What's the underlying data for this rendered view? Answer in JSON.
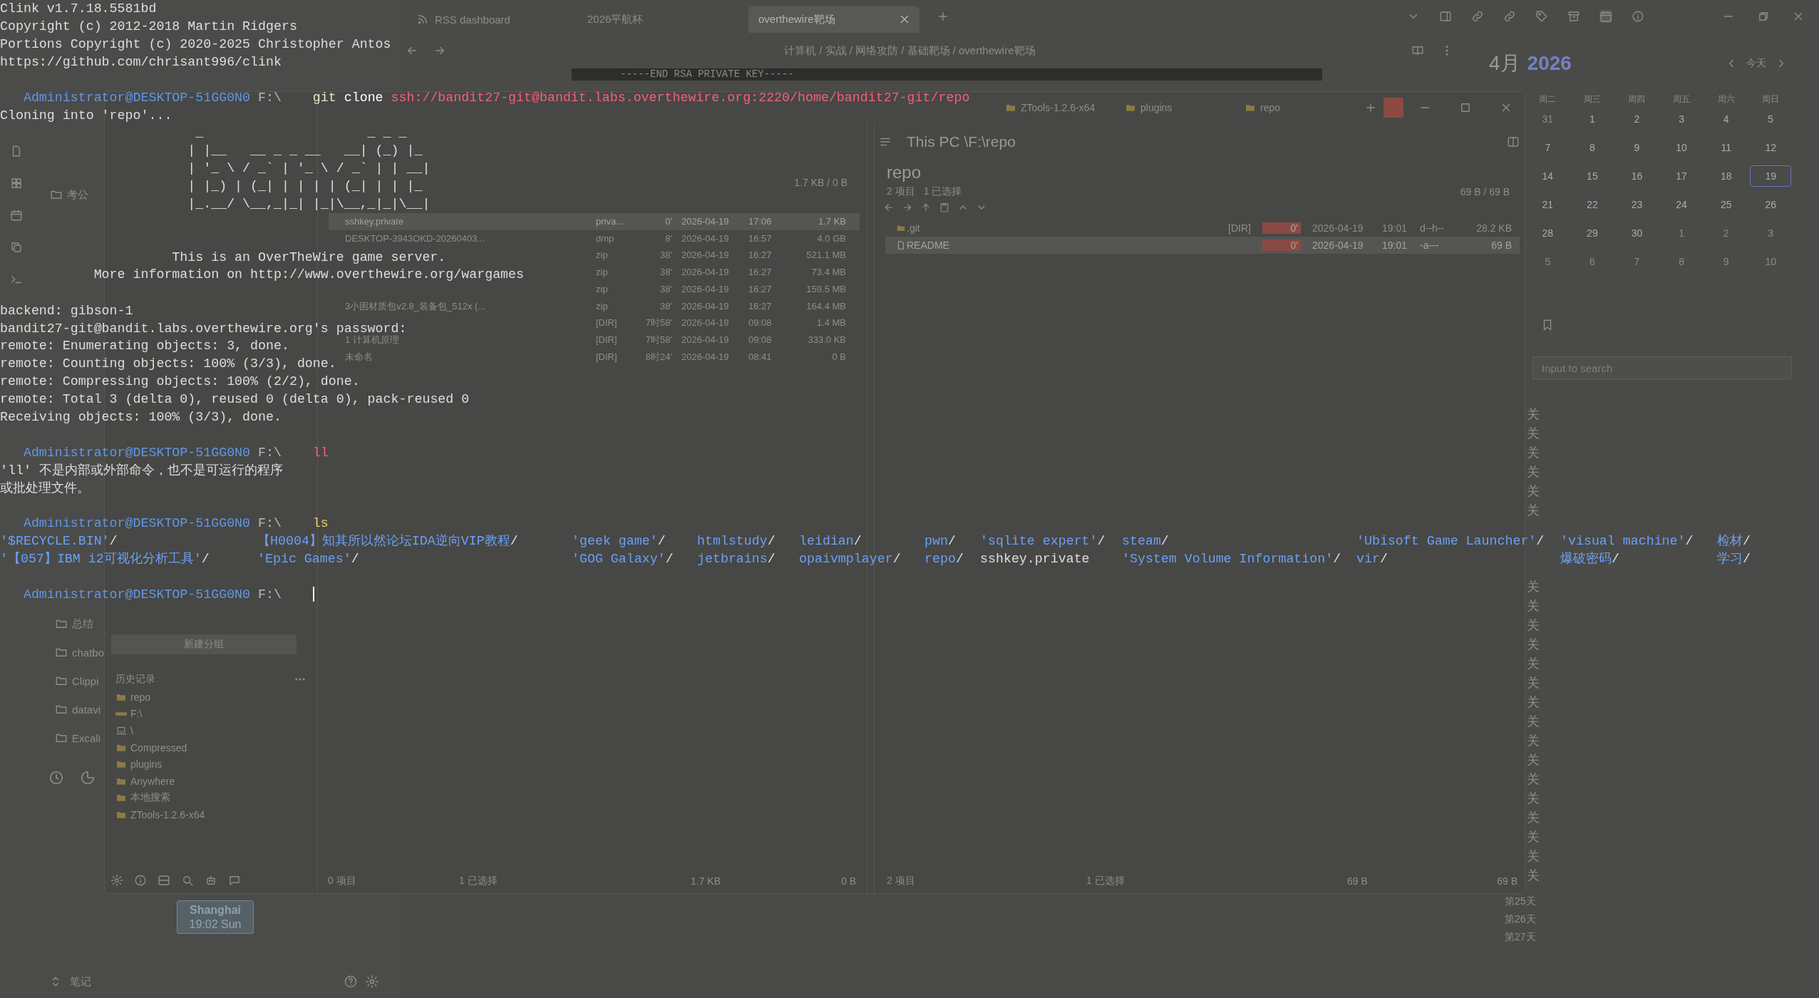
{
  "browser": {
    "tabs": [
      {
        "label": "RSS dashboard",
        "selected": false
      },
      {
        "label": "2026平航杯",
        "selected": false
      },
      {
        "label": "overthewire靶场",
        "selected": true
      }
    ],
    "breadcrumb": "计算机 / 实战 / 网络攻防 / 基础靶场 / overthewire靶场",
    "key_line": "-----END RSA PRIVATE KEY-----"
  },
  "notes": {
    "folder": "考公",
    "folders": [
      "总结",
      "chatbo",
      "Clippi",
      "datavi",
      "Excali"
    ],
    "clock": {
      "city": "Shanghai",
      "time": "19:02 Sun"
    },
    "footer": "笔记"
  },
  "calendar": {
    "month": "4月",
    "year": "2026",
    "today_button": "今天",
    "weekdays": [
      "周二",
      "周三",
      "周四",
      "周五",
      "周六",
      "周日"
    ],
    "weeks": [
      [
        {
          "day": "31",
          "outside": true,
          "selected": false
        },
        {
          "day": "1",
          "outside": false,
          "selected": false
        },
        {
          "day": "2",
          "outside": false,
          "selected": false
        },
        {
          "day": "3",
          "outside": false,
          "selected": false
        },
        {
          "day": "4",
          "outside": false,
          "selected": false
        },
        {
          "day": "5",
          "outside": false,
          "selected": false
        }
      ],
      [
        {
          "day": "7",
          "outside": false,
          "selected": false
        },
        {
          "day": "8",
          "outside": false,
          "selected": false
        },
        {
          "day": "9",
          "outside": false,
          "selected": false
        },
        {
          "day": "10",
          "outside": false,
          "selected": false
        },
        {
          "day": "11",
          "outside": false,
          "selected": false
        },
        {
          "day": "12",
          "outside": false,
          "selected": false
        }
      ],
      [
        {
          "day": "14",
          "outside": false,
          "selected": false
        },
        {
          "day": "15",
          "outside": false,
          "selected": false
        },
        {
          "day": "16",
          "outside": false,
          "selected": false
        },
        {
          "day": "17",
          "outside": false,
          "selected": false
        },
        {
          "day": "18",
          "outside": false,
          "selected": false
        },
        {
          "day": "19",
          "outside": false,
          "selected": true
        }
      ],
      [
        {
          "day": "21",
          "outside": false,
          "selected": false
        },
        {
          "day": "22",
          "outside": false,
          "selected": false
        },
        {
          "day": "23",
          "outside": false,
          "selected": false
        },
        {
          "day": "24",
          "outside": false,
          "selected": false
        },
        {
          "day": "25",
          "outside": false,
          "selected": false
        },
        {
          "day": "26",
          "outside": false,
          "selected": false
        }
      ],
      [
        {
          "day": "28",
          "outside": false,
          "selected": false
        },
        {
          "day": "29",
          "outside": false,
          "selected": false
        },
        {
          "day": "30",
          "outside": false,
          "selected": false
        },
        {
          "day": "1",
          "outside": true,
          "selected": false
        },
        {
          "day": "2",
          "outside": true,
          "selected": false
        },
        {
          "day": "3",
          "outside": true,
          "selected": false
        }
      ],
      [
        {
          "day": "5",
          "outside": true,
          "selected": false
        },
        {
          "day": "6",
          "outside": true,
          "selected": false
        },
        {
          "day": "7",
          "outside": true,
          "selected": false
        },
        {
          "day": "8",
          "outside": true,
          "selected": false
        },
        {
          "day": "9",
          "outside": true,
          "selected": false
        },
        {
          "day": "10",
          "outside": true,
          "selected": false
        }
      ]
    ],
    "search": {
      "placeholder": "Input to search"
    },
    "cut_labels_upper": [
      "关",
      "关",
      "关",
      "关",
      "关",
      "关"
    ],
    "cut_labels_lower": [
      "关",
      "关",
      "关",
      "关",
      "关",
      "关",
      "关",
      "关",
      "关",
      "关",
      "关",
      "关",
      "关",
      "关",
      "关",
      "关"
    ],
    "day_labels": [
      "第25天",
      "第26天",
      "第27天"
    ]
  },
  "file_manager": {
    "tabs": [
      {
        "label": "ZTools-1.2.6-x64"
      },
      {
        "label": "plugins"
      },
      {
        "label": "repo"
      }
    ],
    "sidebar": {
      "new_group_button": "新建分组",
      "history_title": "历史记录",
      "history": [
        {
          "label": "repo",
          "kind": "folder"
        },
        {
          "label": "F:\\",
          "kind": "drive"
        },
        {
          "label": "\\",
          "kind": "computer"
        },
        {
          "label": "Compressed",
          "kind": "folder"
        },
        {
          "label": "plugins",
          "kind": "folder"
        },
        {
          "label": "Anywhere",
          "kind": "folder"
        },
        {
          "label": "本地搜索",
          "kind": "folder"
        },
        {
          "label": "ZTools-1.2.6-x64",
          "kind": "folder"
        }
      ]
    },
    "left_panel": {
      "summary": "1.7 KB / 0 B",
      "rows": [
        {
          "name": "sshkey.private",
          "type": "priva...",
          "age": "0'",
          "date": "2026-04-19",
          "time": "17:06",
          "size": "1.7 KB",
          "selected": true
        },
        {
          "name": "DESKTOP-3943OKD-20260403...",
          "type": "dmp",
          "age": "8'",
          "date": "2026-04-19",
          "time": "16:57",
          "size": "4.0 GB",
          "selected": false
        },
        {
          "type": "zip",
          "age": "38'",
          "date": "2026-04-19",
          "time": "16:27",
          "size": "521.1 MB",
          "selected": false
        },
        {
          "type": "zip",
          "age": "38'",
          "date": "2026-04-19",
          "time": "16:27",
          "size": "73.4 MB",
          "selected": false
        },
        {
          "type": "zip",
          "age": "38'",
          "date": "2026-04-19",
          "time": "16:27",
          "size": "159.5 MB",
          "selected": false
        },
        {
          "name": "3小困材质包v2.8_装备包_512x (...",
          "type": "zip",
          "age": "38'",
          "date": "2026-04-19",
          "time": "16:27",
          "size": "164.4 MB",
          "selected": false
        },
        {
          "type": "[DIR]",
          "age": "7时58'",
          "date": "2026-04-19",
          "time": "09:08",
          "size": "1.4 MB",
          "selected": false
        },
        {
          "name": "1 计算机原理",
          "type": "[DIR]",
          "age": "7时58'",
          "date": "2026-04-19",
          "time": "09:08",
          "size": "333.0 KB",
          "selected": false
        },
        {
          "name": "未命名",
          "type": "[DIR]",
          "age": "8时24'",
          "date": "2026-04-19",
          "time": "08:41",
          "size": "0 B",
          "selected": false
        }
      ],
      "status": [
        "0 项目",
        "1 已选择",
        "1.7 KB",
        "0 B"
      ]
    },
    "right_panel": {
      "path": "This PC \\F:\\repo",
      "title": "repo",
      "summary": [
        "2 项目",
        "1 已选择"
      ],
      "size_summary": "69 B / 69 B",
      "rows": [
        {
          "kind": "folder",
          "name": ".git",
          "type": "[DIR]",
          "age": "0'",
          "date": "2026-04-19",
          "time": "19:01",
          "attrs": "d--h--",
          "size": "28.2 KB",
          "selected": false
        },
        {
          "kind": "file",
          "name": "README",
          "age": "0'",
          "date": "2026-04-19",
          "time": "19:01",
          "attrs": "-a---",
          "size": "69 B",
          "selected": true
        }
      ],
      "status": [
        "2 项目",
        "1 已选择",
        "69 B",
        "69 B"
      ]
    }
  },
  "terminal": {
    "lines": [
      {
        "kind": "text",
        "text": "Clink v1.7.18.5581bd"
      },
      {
        "kind": "text",
        "text": "Copyright (c) 2012-2018 Martin Ridgers"
      },
      {
        "kind": "text",
        "text": "Portions Copyright (c) 2020-2025 Christopher Antos"
      },
      {
        "kind": "text",
        "text": "https://github.com/chrisant996/clink"
      },
      {
        "kind": "blank"
      },
      {
        "kind": "prompt",
        "user": "Administrator@DESKTOP-51GG0N0",
        "path": "F:\\",
        "command": [
          {
            "text": "git",
            "kind": "program"
          },
          {
            "text": "clone",
            "kind": "arg"
          },
          {
            "text": "ssh://bandit27-git@bandit.labs.overthewire.org:2220/home/bandit27-git/repo",
            "kind": "url"
          }
        ],
        "cursor": false
      },
      {
        "kind": "text",
        "text": "Cloning into 'repo'..."
      },
      {
        "kind": "art",
        "lines": [
          " _                     _ _ _",
          "| |__   __ _ _ __   __| (_) |_",
          "| '_ \\ / _` | '_ \\ / _` | | __|",
          "| |_) | (_| | | | | (_| | | |_",
          "|_.__/ \\__,_|_| |_|\\__,_|_|\\__|"
        ]
      },
      {
        "kind": "blank"
      },
      {
        "kind": "blank"
      },
      {
        "kind": "banner",
        "text": "This is an OverTheWire game server."
      },
      {
        "kind": "banner",
        "text": "More information on http://www.overthewire.org/wargames"
      },
      {
        "kind": "blank"
      },
      {
        "kind": "text",
        "text": "backend: gibson-1"
      },
      {
        "kind": "text",
        "text": "bandit27-git@bandit.labs.overthewire.org's password:"
      },
      {
        "kind": "text",
        "text": "remote: Enumerating objects: 3, done."
      },
      {
        "kind": "text",
        "text": "remote: Counting objects: 100% (3/3), done."
      },
      {
        "kind": "text",
        "text": "remote: Compressing objects: 100% (2/2), done."
      },
      {
        "kind": "text",
        "text": "remote: Total 3 (delta 0), reused 0 (delta 0), pack-reused 0"
      },
      {
        "kind": "text",
        "text": "Receiving objects: 100% (3/3), done."
      },
      {
        "kind": "blank"
      },
      {
        "kind": "prompt",
        "user": "Administrator@DESKTOP-51GG0N0",
        "path": "F:\\",
        "command": [
          {
            "text": "ll",
            "kind": "unknown"
          }
        ],
        "cursor": false
      },
      {
        "kind": "text",
        "text": "'ll' 不是内部或外部命令，也不是可运行的程序"
      },
      {
        "kind": "text",
        "text": "或批处理文件。"
      },
      {
        "kind": "blank"
      },
      {
        "kind": "prompt",
        "user": "Administrator@DESKTOP-51GG0N0",
        "path": "F:\\",
        "command": [
          {
            "text": "ls",
            "kind": "builtin"
          }
        ],
        "cursor": false
      },
      {
        "kind": "ls",
        "entries": [
          {
            "name": "'$RECYCLE.BIN'",
            "suffix": "/",
            "kind": "dir"
          },
          {
            "name": "【H0004】知其所以然论坛IDA逆向VIP教程",
            "suffix": "/",
            "kind": "dir"
          },
          {
            "name": "'geek game'",
            "suffix": "/",
            "kind": "dir"
          },
          {
            "name": "htmlstudy",
            "suffix": "/",
            "kind": "dir"
          },
          {
            "name": "leidian",
            "suffix": "/",
            "kind": "dir"
          },
          {
            "name": "pwn",
            "suffix": "/",
            "kind": "dir"
          },
          {
            "name": "'sqlite expert'",
            "suffix": "/",
            "kind": "dir"
          },
          {
            "name": "steam",
            "suffix": "/",
            "kind": "dir"
          },
          {
            "name": "'Ubisoft Game Launcher'",
            "suffix": "/",
            "kind": "dir"
          },
          {
            "name": "'visual machine'",
            "suffix": "/",
            "kind": "dir"
          },
          {
            "name": "检材",
            "suffix": "/",
            "kind": "dir"
          }
        ]
      },
      {
        "kind": "ls",
        "entries": [
          {
            "name": "'【057】IBM i2可视化分析工具'",
            "suffix": "/",
            "kind": "dir"
          },
          {
            "name": "'Epic Games'",
            "suffix": "/",
            "kind": "dir"
          },
          {
            "name": "'GOG Galaxy'",
            "suffix": "/",
            "kind": "dir"
          },
          {
            "name": "jetbrains",
            "suffix": "/",
            "kind": "dir"
          },
          {
            "name": "opaivmplayer",
            "suffix": "/",
            "kind": "dir"
          },
          {
            "name": "repo",
            "suffix": "/",
            "kind": "dir"
          },
          {
            "name": "sshkey.private",
            "kind": "file"
          },
          {
            "name": "'System Volume Information'",
            "suffix": "/",
            "kind": "dir"
          },
          {
            "name": "vir",
            "suffix": "/",
            "kind": "dir"
          },
          {
            "name": "爆破密码",
            "suffix": "/",
            "kind": "dir"
          },
          {
            "name": "学习",
            "suffix": "/",
            "kind": "dir"
          }
        ]
      },
      {
        "kind": "blank"
      },
      {
        "kind": "prompt",
        "user": "Administrator@DESKTOP-51GG0N0",
        "path": "F:\\",
        "cursor": true
      }
    ]
  }
}
